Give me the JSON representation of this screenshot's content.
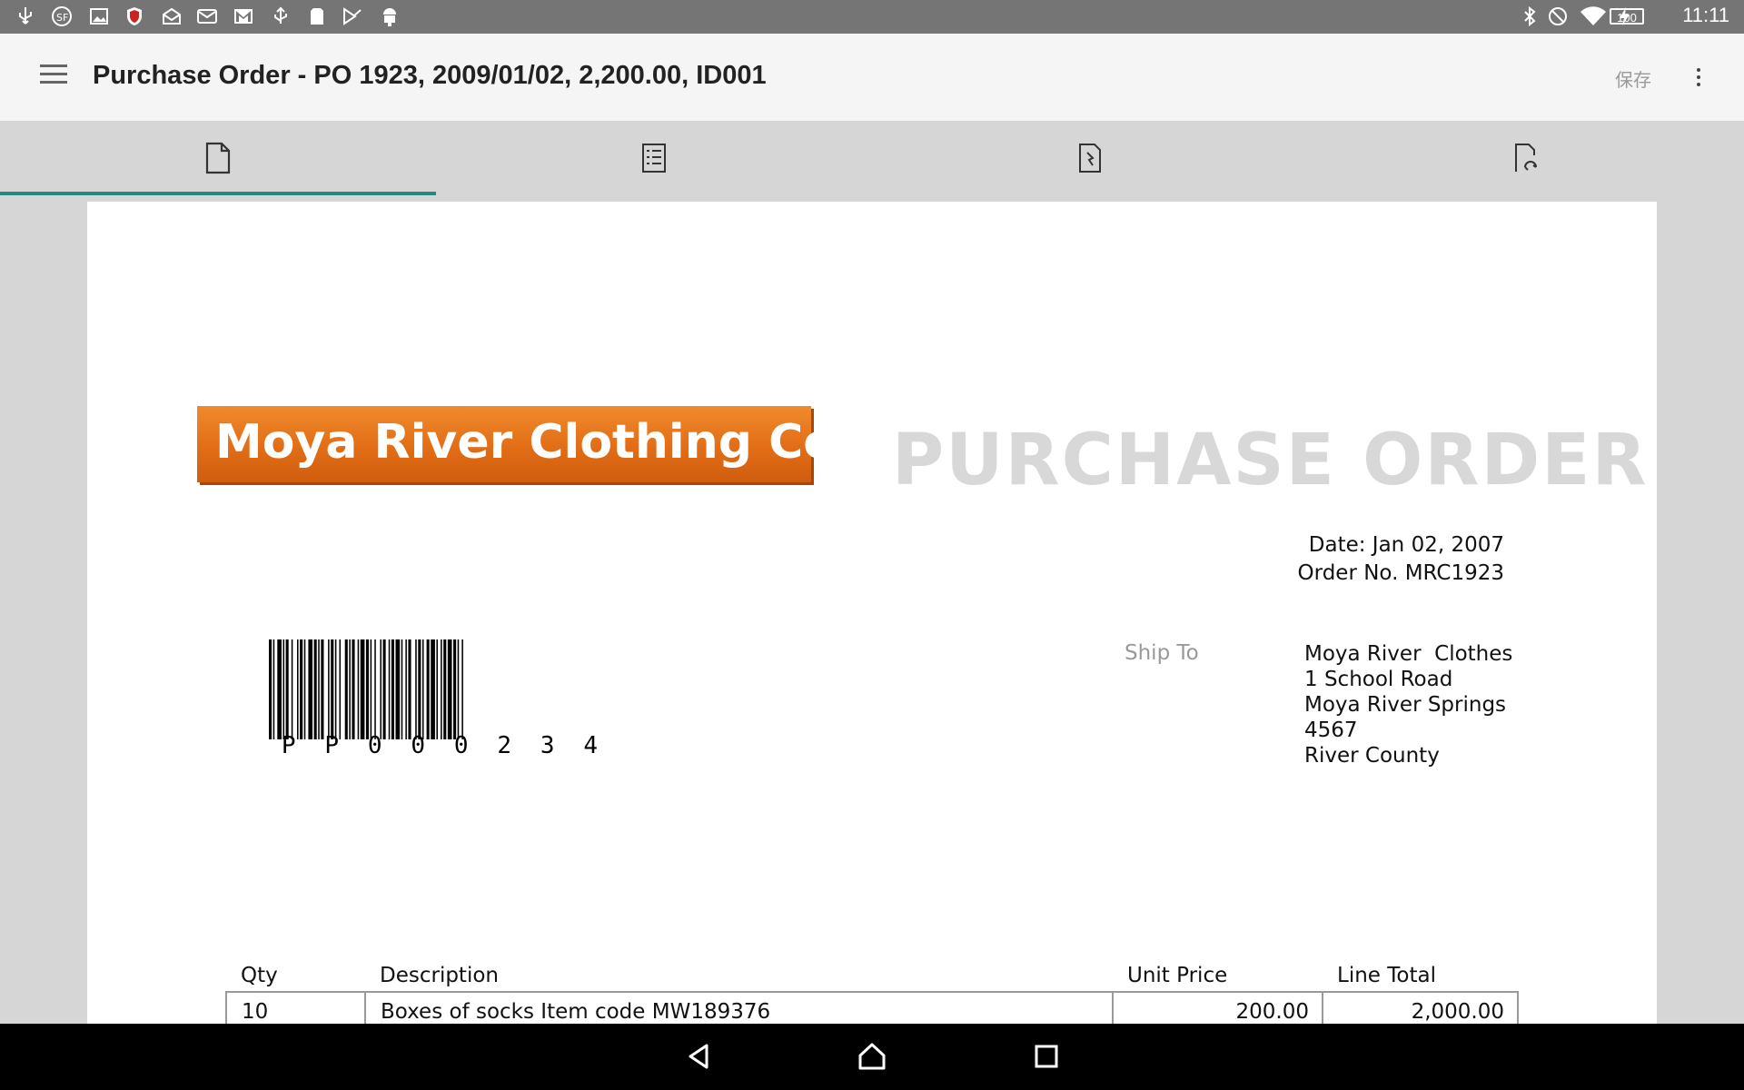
{
  "status_bar": {
    "time": "11:11",
    "battery": "100",
    "left_icons": [
      "usb-icon",
      "sf-app-icon",
      "image-icon",
      "mcafee-icon",
      "mail-open-icon",
      "mail-icon",
      "gmail-icon",
      "usb-debug-icon",
      "sim-icon",
      "play-store-icon",
      "android-icon"
    ],
    "right_icons": [
      "bluetooth-icon",
      "dnd-icon",
      "wifi-icon",
      "charging-icon"
    ]
  },
  "app_bar": {
    "title": "Purchase Order - PO 1923, 2009/01/02, 2,200.00, ID001",
    "save_label": "保存"
  },
  "tabs": [
    {
      "icon": "document-icon",
      "selected": true
    },
    {
      "icon": "checklist-icon",
      "selected": false
    },
    {
      "icon": "document-sign-icon",
      "selected": false
    },
    {
      "icon": "document-recycle-icon",
      "selected": false
    }
  ],
  "document": {
    "company_logo": "Moya River Clothing Co.",
    "heading": "PURCHASE ORDER",
    "date_line": "Date: Jan 02, 2007",
    "order_line": "Order No. MRC1923",
    "barcode_text": [
      "P",
      "P",
      "0",
      "0",
      "0",
      "2",
      "3",
      "4"
    ],
    "ship_to_label": "Ship To",
    "ship_to_address": [
      "Moya River  Clothes",
      "1 School Road",
      "Moya River Springs",
      "4567",
      "River County"
    ],
    "table": {
      "headers": [
        "Qty",
        "Description",
        "Unit Price",
        "Line Total"
      ],
      "rows": [
        [
          "10",
          "Boxes of socks Item code MW189376",
          "200.00",
          "2,000.00"
        ]
      ]
    }
  },
  "colors": {
    "accent": "#26897c",
    "logo_orange": "#e26d16",
    "status_bar": "#757575"
  }
}
